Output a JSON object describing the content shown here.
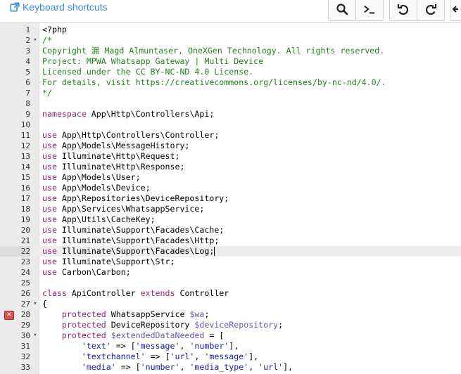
{
  "toolbar": {
    "shortcuts_label": "Keyboard shortcuts",
    "buttons": [
      {
        "name": "search-button",
        "icon": "search-icon"
      },
      {
        "name": "terminal-button",
        "icon": "terminal-icon"
      },
      {
        "name": "undo-button",
        "icon": "undo-icon"
      },
      {
        "name": "redo-button",
        "icon": "redo-icon"
      },
      {
        "name": "back-button",
        "icon": "arrow-left-icon"
      }
    ]
  },
  "colors": {
    "link": "#3a8dde",
    "keyword": "#93257a",
    "comment": "#23841b",
    "variable": "#6d54a6",
    "string": "#1a1aa6",
    "error": "#d9534f"
  },
  "editor": {
    "active_line": 22,
    "error_line": 28,
    "lines": [
      {
        "n": "1",
        "tokens": [
          [
            "ph",
            "<?php"
          ]
        ]
      },
      {
        "n": "2",
        "fold": true,
        "tokens": [
          [
            "cm",
            "/*"
          ]
        ]
      },
      {
        "n": "3",
        "tokens": [
          [
            "cm",
            "Copyright 漏 Magd Almuntaser, OneXGen Technology. All rights reserved."
          ]
        ]
      },
      {
        "n": "4",
        "tokens": [
          [
            "cm",
            "Project: MPWA Whatsapp Gateway | Multi Device"
          ]
        ]
      },
      {
        "n": "5",
        "tokens": [
          [
            "cm",
            "Licensed under the CC BY-NC-ND 4.0 License."
          ]
        ]
      },
      {
        "n": "6",
        "tokens": [
          [
            "cm",
            "For details, visit https://creativecommons.org/licenses/by-nc-nd/4.0/."
          ]
        ]
      },
      {
        "n": "7",
        "tokens": [
          [
            "cm",
            "*/"
          ]
        ]
      },
      {
        "n": "8",
        "tokens": []
      },
      {
        "n": "9",
        "tokens": [
          [
            "kw",
            "namespace"
          ],
          [
            "tx",
            " App\\Http\\Controllers\\Api;"
          ]
        ]
      },
      {
        "n": "10",
        "tokens": []
      },
      {
        "n": "11",
        "tokens": [
          [
            "kw",
            "use"
          ],
          [
            "tx",
            " App\\Http\\Controllers\\Controller;"
          ]
        ]
      },
      {
        "n": "12",
        "tokens": [
          [
            "kw",
            "use"
          ],
          [
            "tx",
            " App\\Models\\MessageHistory;"
          ]
        ]
      },
      {
        "n": "13",
        "tokens": [
          [
            "kw",
            "use"
          ],
          [
            "tx",
            " Illuminate\\Http\\Request;"
          ]
        ]
      },
      {
        "n": "14",
        "tokens": [
          [
            "kw",
            "use"
          ],
          [
            "tx",
            " Illuminate\\Http\\Response;"
          ]
        ]
      },
      {
        "n": "15",
        "tokens": [
          [
            "kw",
            "use"
          ],
          [
            "tx",
            " App\\Models\\User;"
          ]
        ]
      },
      {
        "n": "16",
        "tokens": [
          [
            "kw",
            "use"
          ],
          [
            "tx",
            " App\\Models\\Device;"
          ]
        ]
      },
      {
        "n": "17",
        "tokens": [
          [
            "kw",
            "use"
          ],
          [
            "tx",
            " App\\Repositories\\DeviceRepository;"
          ]
        ]
      },
      {
        "n": "18",
        "tokens": [
          [
            "kw",
            "use"
          ],
          [
            "tx",
            " App\\Services\\WhatsappService;"
          ]
        ]
      },
      {
        "n": "19",
        "tokens": [
          [
            "kw",
            "use"
          ],
          [
            "tx",
            " App\\Utils\\CacheKey;"
          ]
        ]
      },
      {
        "n": "20",
        "tokens": [
          [
            "kw",
            "use"
          ],
          [
            "tx",
            " Illuminate\\Support\\Facades\\Cache;"
          ]
        ]
      },
      {
        "n": "21",
        "tokens": [
          [
            "kw",
            "use"
          ],
          [
            "tx",
            " Illuminate\\Support\\Facades\\Http;"
          ]
        ]
      },
      {
        "n": "22",
        "tokens": [
          [
            "kw",
            "use"
          ],
          [
            "tx",
            " Illuminate\\Support\\Facades\\Log;"
          ]
        ],
        "caret": true
      },
      {
        "n": "23",
        "tokens": [
          [
            "kw",
            "use"
          ],
          [
            "tx",
            " Illuminate\\Support\\Str;"
          ]
        ]
      },
      {
        "n": "24",
        "tokens": [
          [
            "kw",
            "use"
          ],
          [
            "tx",
            " Carbon\\Carbon;"
          ]
        ]
      },
      {
        "n": "25",
        "tokens": []
      },
      {
        "n": "26",
        "tokens": [
          [
            "kw",
            "class"
          ],
          [
            "tx",
            " ApiController "
          ],
          [
            "kw",
            "extends"
          ],
          [
            "tx",
            " Controller"
          ]
        ]
      },
      {
        "n": "27",
        "fold": true,
        "tokens": [
          [
            "tx",
            "{"
          ]
        ]
      },
      {
        "n": "28",
        "error": true,
        "tokens": [
          [
            "tx",
            "    "
          ],
          [
            "kw",
            "protected"
          ],
          [
            "tx",
            " WhatsappService "
          ],
          [
            "var",
            "$wa"
          ],
          [
            "tx",
            ";"
          ]
        ]
      },
      {
        "n": "29",
        "tokens": [
          [
            "tx",
            "    "
          ],
          [
            "kw",
            "protected"
          ],
          [
            "tx",
            " DeviceRepository "
          ],
          [
            "var",
            "$deviceRepository"
          ],
          [
            "tx",
            ";"
          ]
        ]
      },
      {
        "n": "30",
        "fold": true,
        "tokens": [
          [
            "tx",
            "    "
          ],
          [
            "kw",
            "protected"
          ],
          [
            "tx",
            " "
          ],
          [
            "var",
            "$extendedDataNeeded"
          ],
          [
            "tx",
            " = ["
          ]
        ]
      },
      {
        "n": "31",
        "tokens": [
          [
            "tx",
            "        "
          ],
          [
            "str",
            "'text'"
          ],
          [
            "tx",
            " => ["
          ],
          [
            "str",
            "'message'"
          ],
          [
            "tx",
            ", "
          ],
          [
            "str",
            "'number'"
          ],
          [
            "tx",
            "],"
          ]
        ]
      },
      {
        "n": "32",
        "tokens": [
          [
            "tx",
            "        "
          ],
          [
            "str",
            "'textchannel'"
          ],
          [
            "tx",
            " => ["
          ],
          [
            "str",
            "'url'"
          ],
          [
            "tx",
            ", "
          ],
          [
            "str",
            "'message'"
          ],
          [
            "tx",
            "],"
          ]
        ]
      },
      {
        "n": "33",
        "tokens": [
          [
            "tx",
            "        "
          ],
          [
            "str",
            "'media'"
          ],
          [
            "tx",
            " => ["
          ],
          [
            "str",
            "'number'"
          ],
          [
            "tx",
            ", "
          ],
          [
            "str",
            "'media_type'"
          ],
          [
            "tx",
            ", "
          ],
          [
            "str",
            "'url'"
          ],
          [
            "tx",
            "],"
          ]
        ]
      }
    ]
  }
}
